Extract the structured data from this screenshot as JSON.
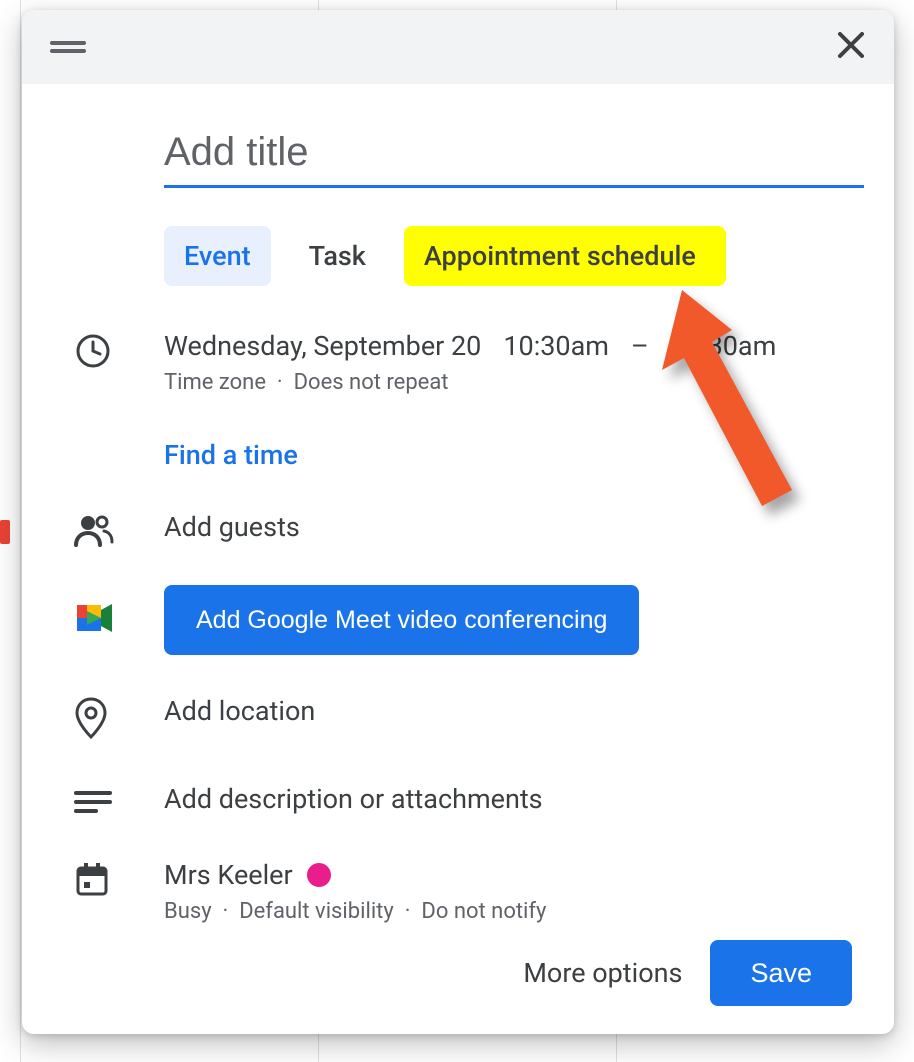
{
  "title_placeholder": "Add title",
  "tabs": {
    "event": "Event",
    "task": "Task",
    "appointment": "Appointment schedule"
  },
  "datetime": {
    "date": "Wednesday, September 20",
    "start": "10:30am",
    "separator": "–",
    "end": "11:30am",
    "timezone_label": "Time zone",
    "repeat_label": "Does not repeat"
  },
  "find_a_time": "Find a time",
  "guests_placeholder": "Add guests",
  "meet_button": "Add Google Meet video conferencing",
  "location_placeholder": "Add location",
  "description_placeholder": "Add description or attachments",
  "calendar": {
    "name": "Mrs Keeler",
    "color": "#e91e8c",
    "availability": "Busy",
    "visibility": "Default visibility",
    "notify": "Do not notify"
  },
  "footer": {
    "more_options": "More options",
    "save": "Save"
  }
}
